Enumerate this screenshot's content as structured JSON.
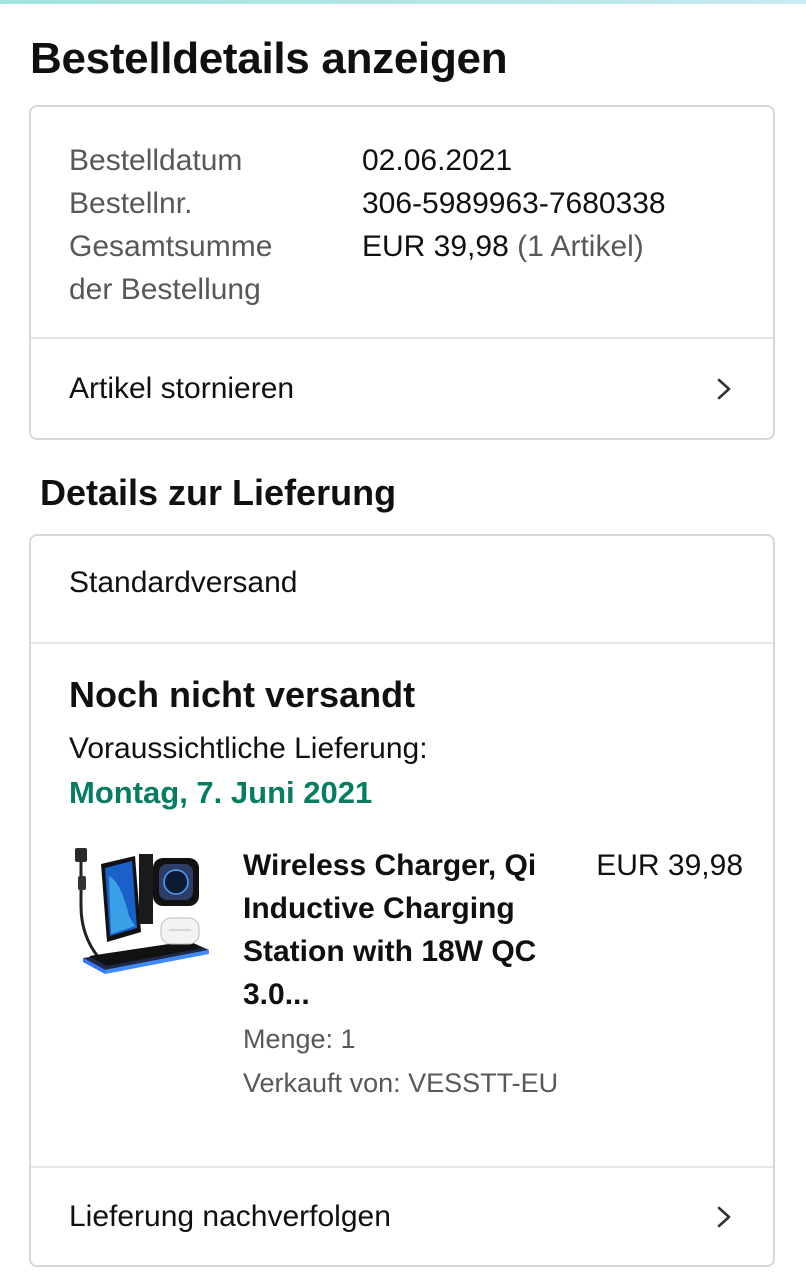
{
  "page": {
    "title": "Bestelldetails anzeigen"
  },
  "order_summary": {
    "rows": [
      {
        "label": "Bestelldatum",
        "value": "02.06.2021"
      },
      {
        "label": "Bestellnr.",
        "value": "306-5989963-7680338"
      },
      {
        "label_line1": "Gesamtsumme",
        "label_line2": "der Bestellung",
        "value": "EUR 39,98",
        "value_note": "(1 Artikel)"
      }
    ],
    "cancel_label": "Artikel stornieren"
  },
  "delivery": {
    "section_title": "Details zur Lieferung",
    "shipping_method": "Standardversand",
    "status": "Noch nicht versandt",
    "expected_label": "Voraussichtliche Lieferung:",
    "expected_date": "Montag, 7. Juni 2021",
    "track_label": "Lieferung nachverfolgen"
  },
  "product": {
    "title": "Wireless Charger, Qi Inductive Charging Station with 18W QC 3.0...",
    "price": "EUR 39,98",
    "quantity": "Menge: 1",
    "seller": "Verkauft von: VESSTT-EU"
  },
  "icons": {
    "chevron": "chevron-right-icon",
    "product": "wireless-charger-product-image"
  },
  "colors": {
    "delivery_date": "#067d62",
    "muted_text": "#565959",
    "border": "#d5d9d9"
  }
}
